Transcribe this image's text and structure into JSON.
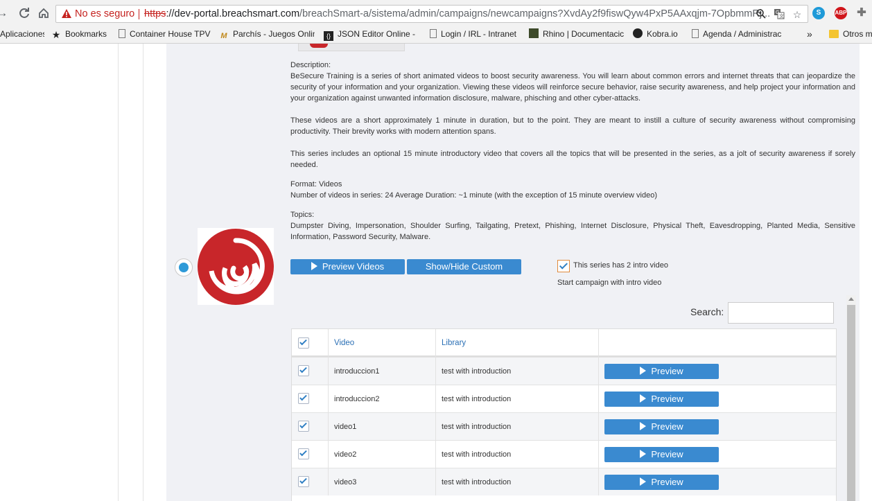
{
  "browser": {
    "security_text": "No es seguro",
    "url_scheme": "https",
    "url_host": "://dev-portal.breachsmart.com",
    "url_path": "/breachSmart-a/sistema/admin/campaigns/newcampaigns?XvdAy2f9fiswQyw4PxP5AAxqjm-7OpbmmRj...",
    "extensions": [
      "skype-icon",
      "abp-icon",
      "puzzle-icon"
    ],
    "abp_label": "ABP",
    "skype_label": "S"
  },
  "bookmarks": [
    {
      "label": "Aplicaciones",
      "icon": "apps-icon"
    },
    {
      "label": "Bookmarks",
      "icon": "star-icon"
    },
    {
      "label": "Container House TPV",
      "icon": "page-icon"
    },
    {
      "label": "Parchís - Juegos Onlin",
      "icon": "parchis-icon"
    },
    {
      "label": "JSON Editor Online -",
      "icon": "json-icon"
    },
    {
      "label": "Login / IRL - Intranet",
      "icon": "page-icon"
    },
    {
      "label": "Rhino | Documentacic",
      "icon": "rhino-icon"
    },
    {
      "label": "Kobra.io",
      "icon": "kobra-icon"
    },
    {
      "label": "Agenda / Administrac",
      "icon": "page-icon"
    },
    {
      "label": "»",
      "icon": "overflow-icon"
    },
    {
      "label": "Otros m",
      "icon": "folder-icon"
    }
  ],
  "series": {
    "description_heading": "Description:",
    "description_p1": "BeSecure Training is a series of short animated videos to boost security awareness. You will learn about common errors and internet threats that can jeopardize the security of your information and your organization. Viewing these videos will reinforce secure behavior, raise security awareness, and help project your information and your organization against unwanted information disclosure, malware, phisching and other cyber-attacks.",
    "description_p2": "These videos are a short approximately 1 minute in duration, but to the point. They are meant to instill a culture of security awareness without compromising productivity. Their brevity works with modern attention spans.",
    "description_p3": "This series includes an optional 15 minute introductory video that covers all the topics that will be presented in the series, as a jolt of security awareness if sorely needed.",
    "format": "Format: Videos",
    "video_count": "Number of videos in series: 24 Average Duration: ~1 minute (with the exception of 15 minute overview video)",
    "topics_heading": "Topics:",
    "topics": "Dumpster Diving, Impersonation, Shoulder Surfing, Tailgating, Pretext, Phishing, Internet Disclosure, Physical Theft, Eavesdropping, Planted Media, Sensitive Information, Password Security, Malware.",
    "preview_videos_label": "Preview Videos",
    "show_hide_label": "Show/Hide Custom",
    "intro_check_label": "This series has 2 intro video",
    "start_intro_label": "Start campaign with intro video",
    "intro_checked": true
  },
  "search": {
    "label": "Search:",
    "value": ""
  },
  "table": {
    "columns": [
      "",
      "Video",
      "Library",
      ""
    ],
    "preview_label": "Preview",
    "rows": [
      {
        "video": "introduccion1",
        "library": "test with introduction",
        "checked": true
      },
      {
        "video": "introduccion2",
        "library": "test with introduction",
        "checked": true
      },
      {
        "video": "video1",
        "library": "test with introduction",
        "checked": true
      },
      {
        "video": "video2",
        "library": "test with introduction",
        "checked": true
      },
      {
        "video": "video3",
        "library": "test with introduction",
        "checked": true
      }
    ]
  },
  "colors": {
    "accent": "#3a8ad0",
    "logo_red": "#c8262a",
    "warning": "#c5221f"
  }
}
